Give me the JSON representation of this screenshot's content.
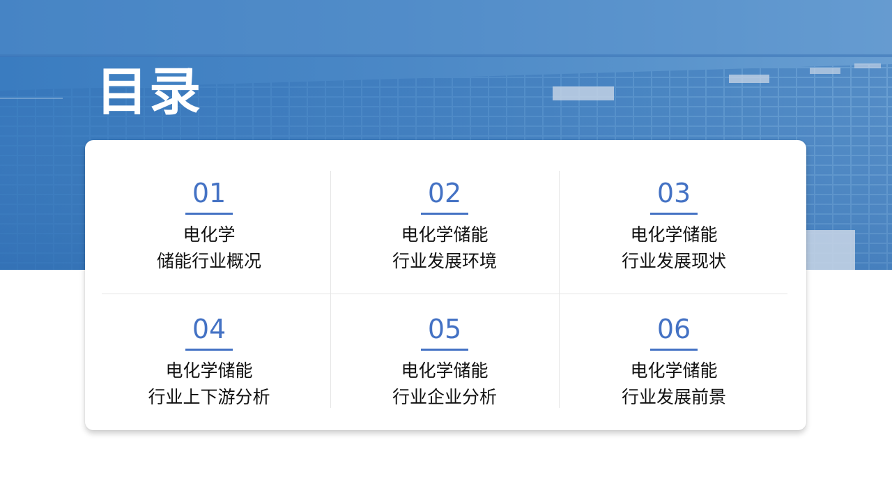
{
  "title": "目录",
  "items": [
    {
      "num": "01",
      "line1": "电化学",
      "line2": "储能行业概况"
    },
    {
      "num": "02",
      "line1": "电化学储能",
      "line2": "行业发展环境"
    },
    {
      "num": "03",
      "line1": "电化学储能",
      "line2": "行业发展现状"
    },
    {
      "num": "04",
      "line1": "电化学储能",
      "line2": "行业上下游分析"
    },
    {
      "num": "05",
      "line1": "电化学储能",
      "line2": "行业企业分析"
    },
    {
      "num": "06",
      "line1": "电化学储能",
      "line2": "行业发展前景"
    }
  ],
  "colors": {
    "accent": "#4472c4",
    "hero": "#4b88c6",
    "text": "#111111"
  }
}
